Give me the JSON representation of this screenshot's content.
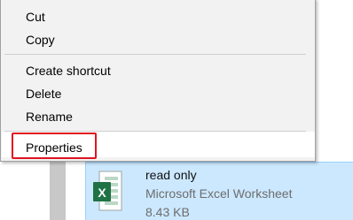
{
  "context_menu": {
    "items": [
      {
        "label": "Cut"
      },
      {
        "label": "Copy"
      },
      {
        "label": "Create shortcut"
      },
      {
        "label": "Delete"
      },
      {
        "label": "Rename"
      },
      {
        "label": "Properties",
        "highlighted": true
      }
    ],
    "highlight_color": "#e0141f"
  },
  "file": {
    "name": "read only",
    "type": "Microsoft Excel Worksheet",
    "size": "8.43 KB",
    "icon": "excel-file-icon",
    "selection_color": "#cce8ff"
  }
}
